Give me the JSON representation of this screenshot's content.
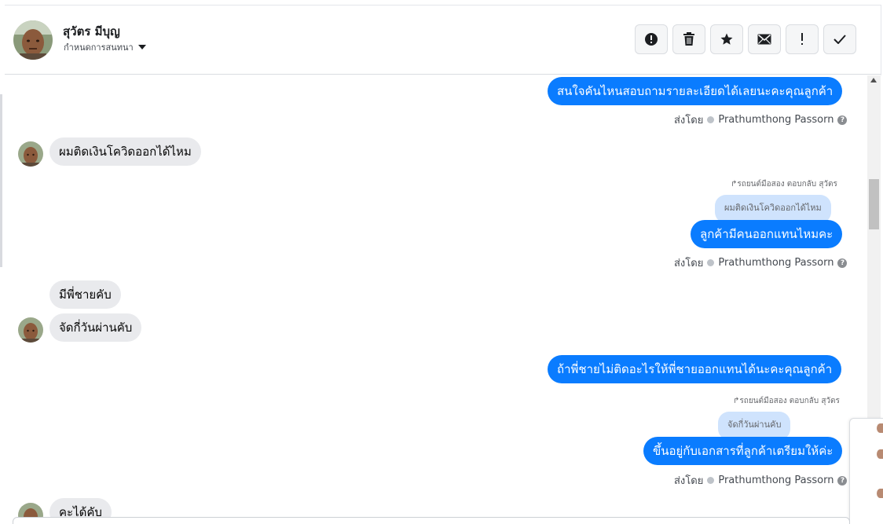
{
  "header": {
    "contact_name": "สุวัตร มีบุญ",
    "conversation_settings": "กำหนดการสนทนา",
    "actions": [
      {
        "name": "spam-icon",
        "label": "Mark as spam"
      },
      {
        "name": "trash-icon",
        "label": "Delete"
      },
      {
        "name": "star-icon",
        "label": "Star"
      },
      {
        "name": "envelope-icon",
        "label": "Mark unread"
      },
      {
        "name": "exclamation-icon",
        "label": "Follow up"
      },
      {
        "name": "check-icon",
        "label": "Mark done"
      }
    ]
  },
  "messages": {
    "m1": "สนใจคันไหนสอบถามรายละเอียดได้เลยนะคะคุณลูกค้า",
    "m2": "ผมติดเงินโควิดออกได้ไหม",
    "m3_reply_meta": "รถยนต์มือสอง ตอบกลับ สุวัตร",
    "m3_quote": "ผมติดเงินโควิดออกได้ไหม",
    "m3": "ลูกค้ามีคนออกแทนไหมคะ",
    "m4": "มีพี่ชายคับ",
    "m5": "จัดกี่วันผ่านคับ",
    "m6": "ถ้าพี่ชายไม่ติดอะไรให้พี่ชายออกแทนได้นะคะคุณลูกค้า",
    "m7_reply_meta": "รถยนต์มือสอง ตอบกลับ สุวัตร",
    "m7_quote": "จัดกี่วันผ่านคับ",
    "m7": "ขึ้นอยู่กับเอกสารที่ลูกค้าเตรียมให้ค่ะ",
    "m8": "คะได้คับ"
  },
  "sent_by": {
    "label": "ส่งโดย",
    "agent": "Prathumthong Passorn",
    "help": "?"
  },
  "colors": {
    "outgoing": "#0a7cff",
    "incoming": "#e9eaed",
    "quote": "#cfe3fd"
  }
}
